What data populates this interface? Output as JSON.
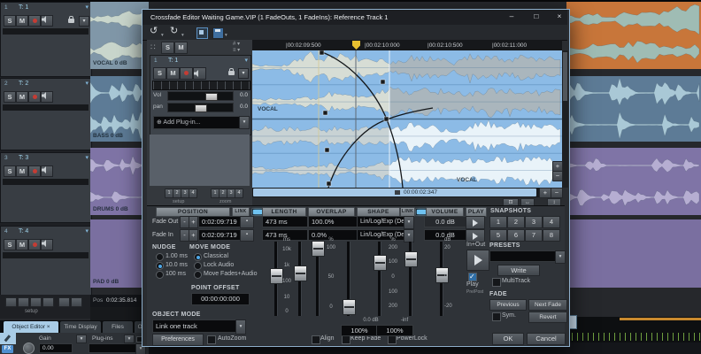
{
  "colors": {
    "accent": "#4f8fd0",
    "selection_blue": "#a9cce6",
    "canvas_bg": "#8cbbe6",
    "clip_orange": "#c8763a",
    "clip_blue": "#5d7b96",
    "clip_purple": "#7f74a6",
    "led_on": "#6fc2f0"
  },
  "window": {
    "title": "Crossfade Editor Waiting Game.VIP (1 FadeOuts, 1 FadeIns): Reference Track 1",
    "minimize": "–",
    "maximize": "□",
    "close": "×"
  },
  "toolbar": {
    "undo": "↺",
    "redo": "↻",
    "menu_arrow": "▾"
  },
  "left_panel": {
    "drag": "∷",
    "solo": "S",
    "mute": "M",
    "track_index": "1",
    "track_name": "T: 1",
    "vol_label": "Vol",
    "vol_value": "0.0",
    "pan_label": "pan",
    "pan_value": "0.0",
    "add_plugin": "⊕  Add Plug-in...",
    "setup": {
      "buttons": [
        "1",
        "2",
        "3",
        "4"
      ],
      "label": "setup"
    },
    "zoom": {
      "buttons": [
        "1",
        "2",
        "3",
        "4"
      ],
      "label": "zoom"
    }
  },
  "ruler": {
    "ticks": [
      "|00:02:09:500",
      "|00:02:10:000",
      "|00:02:10:500",
      "|00:02:11:000"
    ]
  },
  "canvas": {
    "label_top": "VOCAL",
    "label_bottom": "VOCAL",
    "scrollbar_time": "00:00:02:347"
  },
  "sections": {
    "position": "POSITION",
    "link_left": "LINK",
    "length": "LENGTH",
    "overlap": "OVERLAP",
    "shape": "SHAPE",
    "link_right": "LINK",
    "volume": "VOLUME",
    "play": "PLAY",
    "snapshots": "SNAPSHOTS"
  },
  "rows": {
    "fade_out": {
      "label": "Fade Out",
      "minus": "-",
      "plus": "+",
      "grid": "▪",
      "time": "0:02:09:719",
      "length": "473 ms",
      "overlap": "100.0%",
      "shape": "Lin/Log/Exp (Defau",
      "volume": "0.0 dB"
    },
    "fade_in": {
      "label": "Fade In",
      "minus": "-",
      "plus": "+",
      "grid": "▪",
      "time": "0:02:09:719",
      "length": "473 ms",
      "overlap": "0.0%",
      "shape": "Lin/Log/Exp (Defau",
      "volume": "0.0 dB"
    }
  },
  "snapshots": {
    "row1": [
      "1",
      "2",
      "3",
      "4"
    ],
    "row2": [
      "5",
      "6",
      "7",
      "8"
    ]
  },
  "nudge": {
    "title": "NUDGE",
    "options": [
      "1.00 ms",
      "10.0 ms",
      "100 ms"
    ]
  },
  "move_mode": {
    "title": "MOVE MODE",
    "options": [
      "Classical",
      "Lock Audio",
      "Move Fades+Audio"
    ]
  },
  "point_offset": {
    "title": "POINT OFFSET",
    "value": "00:00:00:000"
  },
  "object_mode": {
    "title": "OBJECT MODE",
    "value": "Link one track"
  },
  "faders": {
    "length_ticks": [
      "ms",
      "10k",
      "1k",
      "100",
      "10",
      "0"
    ],
    "overlap_ticks": [
      "%",
      "100",
      "50",
      "0"
    ],
    "shape_ticks": [
      "%",
      "200",
      "100",
      "0",
      "100",
      "200"
    ],
    "volume_ticks": [
      "dB",
      "20",
      "0",
      "-20"
    ],
    "out_level": "0.0 dB",
    "in_level": "-inf",
    "out_pct": "100%",
    "in_pct": "100%"
  },
  "play": {
    "in_out": "In+Out",
    "play": "Play",
    "sub": "Pre/Post"
  },
  "presets": {
    "title": "PRESETS",
    "write": "Write",
    "multitrack": "MultiTrack"
  },
  "fade": {
    "title": "FADE",
    "previous": "Previous",
    "next": "Next Fade",
    "sym": "Sym.",
    "revert": "Revert"
  },
  "footer": {
    "preferences": "Preferences",
    "autozoom": "AutoZoom",
    "align": "Align",
    "keep_fade": "Keep Fade",
    "powerlock": "PowerLock",
    "ok": "OK",
    "cancel": "Cancel"
  },
  "background": {
    "tracks": [
      {
        "index": "1",
        "name": "T: 1",
        "solo": "S",
        "mute": "M",
        "clip_label": "VOCAL 0 dB"
      },
      {
        "index": "2",
        "name": "T: 2",
        "solo": "S",
        "mute": "M",
        "clip_label": "BASS 0 dB"
      },
      {
        "index": "3",
        "name": "T: 3",
        "solo": "S",
        "mute": "M",
        "clip_label": "DRUMS 0 dB"
      },
      {
        "index": "4",
        "name": "T: 4",
        "solo": "S",
        "mute": "M",
        "clip_label": "PAD 0 dB"
      }
    ],
    "setup_label": "setup",
    "pos_label": "Pos",
    "pos_value": "0:02:35.814",
    "tabs": [
      "Object Editor",
      "Time Display",
      "Files",
      "Ob"
    ],
    "object_editor": {
      "fx": "FX",
      "gain": "Gain",
      "gain_value": "0.00",
      "plugins": "Plug-ins"
    }
  }
}
